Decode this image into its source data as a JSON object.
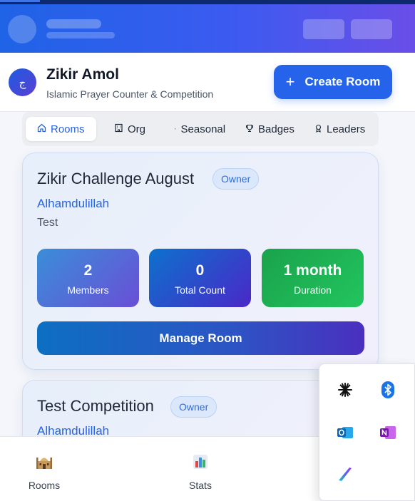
{
  "header": {
    "logo_glyph": "ج",
    "title": "Zikir Amol",
    "subtitle": "Islamic Prayer Counter & Competition",
    "create_button": "Create Room",
    "create_icon": "+"
  },
  "tabs": [
    {
      "label": "Rooms",
      "icon": "home-icon",
      "active": true
    },
    {
      "label": "Org",
      "icon": "building-icon"
    },
    {
      "label": "Seasonal",
      "icon": "dot-icon"
    },
    {
      "label": "Badges",
      "icon": "trophy-icon"
    },
    {
      "label": "Leaders",
      "icon": "award-icon"
    }
  ],
  "rooms": [
    {
      "title": "Zikir Challenge August",
      "role": "Owner",
      "dhikr": "Alhamdulillah",
      "description": "Test",
      "stats": [
        {
          "value": "2",
          "label": "Members"
        },
        {
          "value": "0",
          "label": "Total Count"
        },
        {
          "value": "1 month",
          "label": "Duration"
        }
      ],
      "action": "Manage Room"
    },
    {
      "title": "Test Competition",
      "role": "Owner",
      "dhikr": "Alhamdulillah"
    }
  ],
  "bottom_nav": [
    {
      "label": "Rooms",
      "icon": "mosque-icon"
    },
    {
      "label": "Stats",
      "icon": "bar-chart-icon"
    }
  ],
  "tray_icons": [
    "asterisk-app-icon",
    "bluetooth-icon",
    "outlook-icon",
    "onenote-icon",
    "stylus-app-icon"
  ],
  "colors": {
    "primary": "#2563eb",
    "success": "#22c55e",
    "header_gradient_end": "#6a4ee8"
  }
}
